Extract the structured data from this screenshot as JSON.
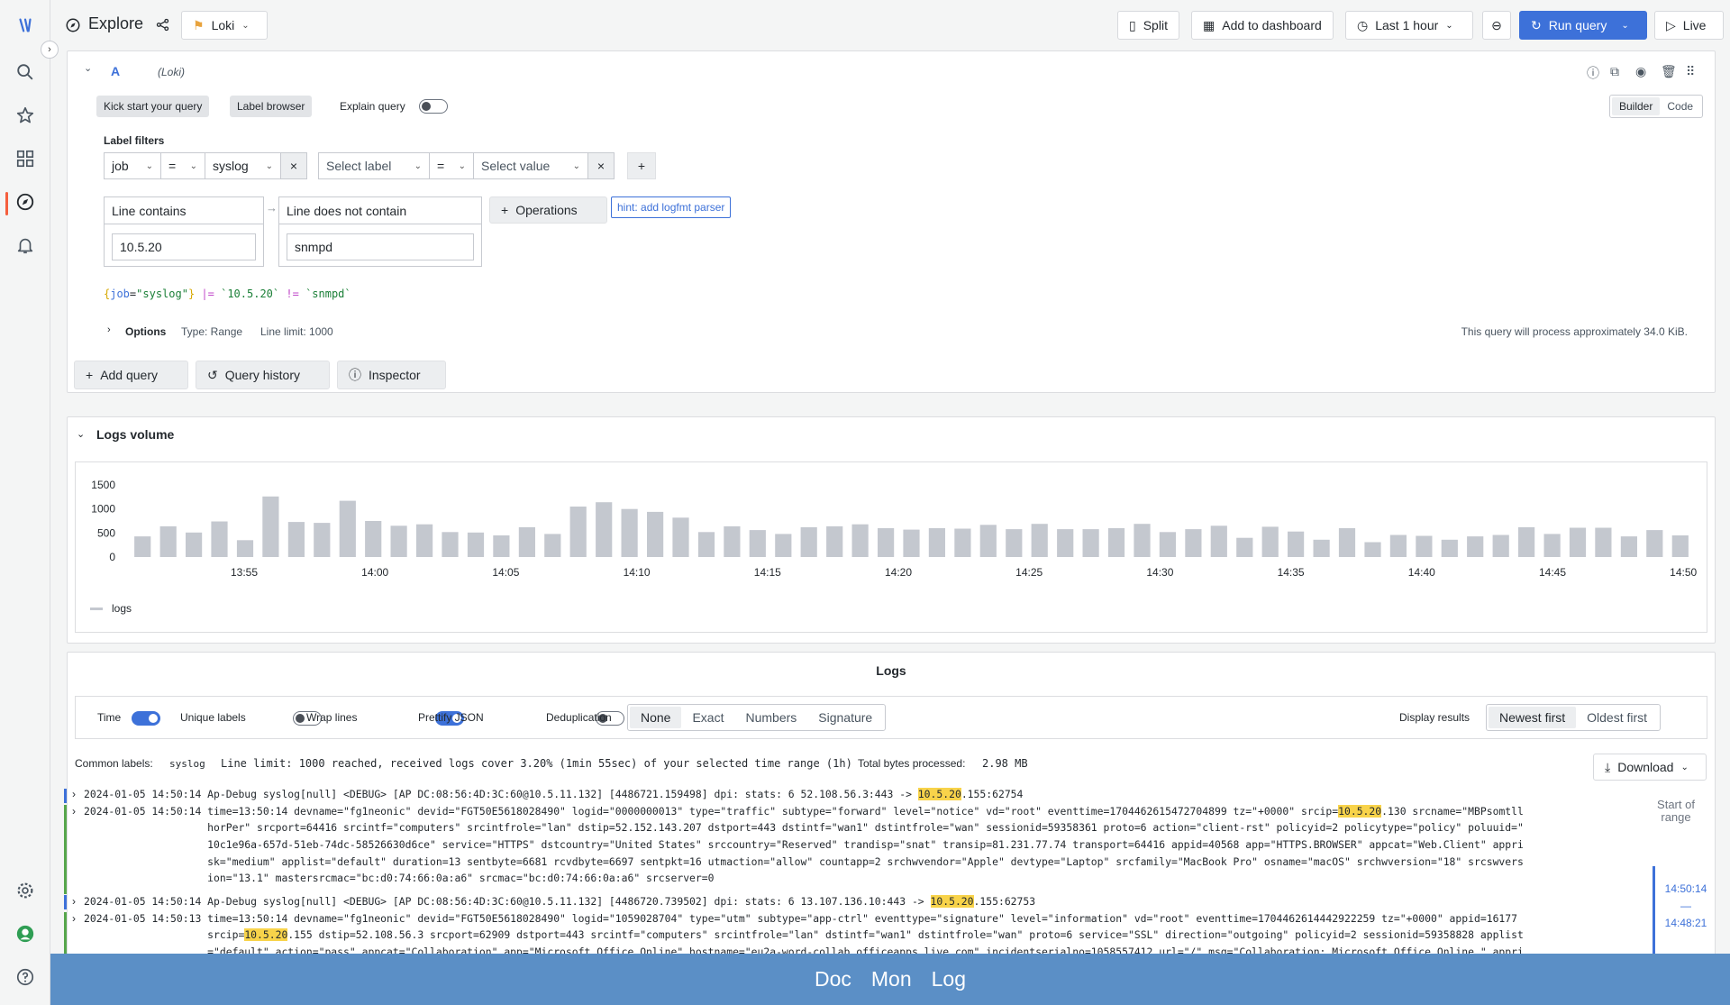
{
  "header": {
    "title": "Explore",
    "datasource": "Loki",
    "split_label": "Split",
    "add_to_dashboard_label": "Add to dashboard",
    "time_range": "Last 1 hour",
    "run_query_label": "Run query",
    "live_label": "Live"
  },
  "query": {
    "ref_id": "A",
    "datasource_tag": "(Loki)",
    "kick_start_label": "Kick start your query",
    "label_browser_label": "Label browser",
    "explain_label": "Explain query",
    "builder_label": "Builder",
    "code_label": "Code",
    "label_filters_title": "Label filters",
    "filter1": {
      "label": "job",
      "op": "=",
      "value": "syslog"
    },
    "filter2": {
      "label": "Select label",
      "op": "=",
      "value": "Select value"
    },
    "op1_title": "Line contains",
    "op1_value": "10.5.20",
    "op2_title": "Line does not contain",
    "op2_value": "snmpd",
    "operations_label": "Operations",
    "hint_label": "hint: add logfmt parser",
    "preview": {
      "p1": "{",
      "p2": "job",
      "p3": "=",
      "p4": "\"syslog\"",
      "p5": "}",
      "p6": "|=",
      "p7": "`10.5.20`",
      "p8": "!=",
      "p9": "`snmpd`"
    },
    "options_label": "Options",
    "type_label": "Type: Range",
    "line_limit_label": "Line limit: 1000",
    "process_info": "This query will process approximately 34.0 KiB."
  },
  "actions": {
    "add_query": "Add query",
    "query_history": "Query history",
    "inspector": "Inspector"
  },
  "volume": {
    "title": "Logs volume",
    "legend": "logs"
  },
  "chart_data": {
    "type": "bar",
    "yticks": [
      "0",
      "500",
      "1000",
      "1500"
    ],
    "ylim": [
      0,
      1500
    ],
    "xticks": [
      "13:55",
      "14:00",
      "14:05",
      "14:10",
      "14:15",
      "14:20",
      "14:25",
      "14:30",
      "14:35",
      "14:40",
      "14:45",
      "14:50"
    ],
    "series": [
      {
        "name": "logs",
        "values": [
          430,
          640,
          510,
          740,
          350,
          1260,
          730,
          710,
          1170,
          750,
          650,
          680,
          520,
          510,
          450,
          620,
          480,
          1050,
          1140,
          1000,
          940,
          820,
          520,
          640,
          560,
          480,
          620,
          640,
          680,
          600,
          570,
          600,
          590,
          670,
          580,
          690,
          580,
          580,
          600,
          690,
          520,
          580,
          650,
          400,
          630,
          530,
          360,
          600,
          310,
          460,
          440,
          360,
          430,
          460,
          620,
          480,
          610,
          610,
          430,
          560,
          450
        ]
      }
    ]
  },
  "logs": {
    "title": "Logs",
    "controls": {
      "time": "Time",
      "unique_labels": "Unique labels",
      "wrap_lines": "Wrap lines",
      "prettify_json": "Prettify JSON",
      "deduplication": "Deduplication",
      "dedup_options": [
        "None",
        "Exact",
        "Numbers",
        "Signature"
      ],
      "display_results": "Display results",
      "order_options": [
        "Newest first",
        "Oldest first"
      ]
    },
    "common_labels_title": "Common labels:",
    "common_labels_value": "syslog",
    "meta": "Line limit: 1000 reached, received logs cover 3.20% (1min 55sec) of your selected time range (1h)",
    "bytes_label": "Total bytes processed:",
    "bytes_value": "2.98 MB",
    "download_label": "Download",
    "nav": {
      "start_range": "Start of range",
      "t1": "14:50:14",
      "dash": "—",
      "t2": "14:48:21"
    },
    "rows": [
      {
        "a": "2024-01-05 14:50:14 Ap-Debug syslog[null] <DEBUG> [AP DC:08:56:4D:3C:60@10.5.11.132] [4486721.159498] dpi: stats: 6 52.108.56.3:443 -> ",
        "h1": "10.5.20",
        "b": ".155:62754"
      },
      {
        "a": "2024-01-05 14:50:14 time=13:50:14 devname=\"fg1neonic\" devid=\"FGT50E5618028490\" logid=\"0000000013\" type=\"traffic\" subtype=\"forward\" level=\"notice\" vd=\"root\" eventtime=1704462615472704899 tz=\"+0000\" srcip=",
        "h1": "10.5.20",
        "b": ".130 srcname=\"MBPsomtll"
      },
      {
        "text": "                    horPer\" srcport=64416 srcintf=\"computers\" srcintfrole=\"lan\" dstip=52.152.143.207 dstport=443 dstintf=\"wan1\" dstintfrole=\"wan\" sessionid=59358361 proto=6 action=\"client-rst\" policyid=2 policytype=\"policy\" poluuid=\""
      },
      {
        "text": "                    10c1e96a-657d-51eb-74dc-58526630d6ce\" service=\"HTTPS\" dstcountry=\"United States\" srccountry=\"Reserved\" trandisp=\"snat\" transip=81.231.77.74 transport=64416 appid=40568 app=\"HTTPS.BROWSER\" appcat=\"Web.Client\" appri"
      },
      {
        "text": "                    sk=\"medium\" applist=\"default\" duration=13 sentbyte=6681 rcvdbyte=6697 sentpkt=16 utmaction=\"allow\" countapp=2 srchwvendor=\"Apple\" devtype=\"Laptop\" srcfamily=\"MacBook Pro\" osname=\"macOS\" srchwversion=\"18\" srcswvers"
      },
      {
        "text": "                    ion=\"13.1\" mastersrcmac=\"bc:d0:74:66:0a:a6\" srcmac=\"bc:d0:74:66:0a:a6\" srcserver=0"
      },
      {
        "a": "2024-01-05 14:50:14 Ap-Debug syslog[null] <DEBUG> [AP DC:08:56:4D:3C:60@10.5.11.132] [4486720.739502] dpi: stats: 6 13.107.136.10:443 -> ",
        "h1": "10.5.20",
        "b": ".155:62753"
      },
      {
        "text": "2024-01-05 14:50:13 time=13:50:14 devname=\"fg1neonic\" devid=\"FGT50E5618028490\" logid=\"1059028704\" type=\"utm\" subtype=\"app-ctrl\" eventtype=\"signature\" level=\"information\" vd=\"root\" eventtime=1704462614442922259 tz=\"+0000\" appid=16177"
      },
      {
        "a": "                    srcip=",
        "h1": "10.5.20",
        "b": ".155 dstip=52.108.56.3 srcport=62909 dstport=443 srcintf=\"computers\" srcintfrole=\"lan\" dstintf=\"wan1\" dstintfrole=\"wan\" proto=6 service=\"SSL\" direction=\"outgoing\" policyid=2 sessionid=59358828 applist"
      },
      {
        "text": "                    =\"default\" action=\"pass\" appcat=\"Collaboration\" app=\"Microsoft.Office.Online\" hostname=\"eu2a-word-collab.officeapps.live.com\" incidentserialno=1058557412 url=\"/\" msg=\"Collaboration: Microsoft.Office.Online,\" appri"
      }
    ]
  },
  "bottom": {
    "doc": "Doc",
    "mon": "Mon",
    "log": "Log"
  }
}
